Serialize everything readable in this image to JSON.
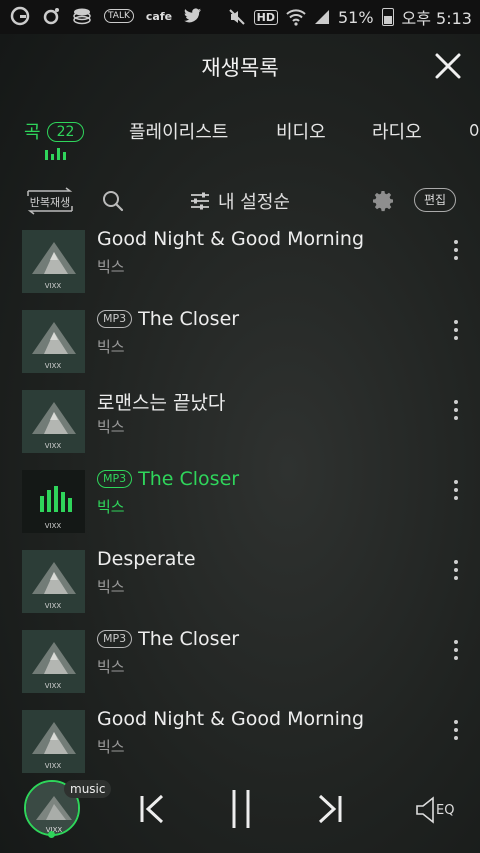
{
  "status_bar": {
    "left_icons": [
      "g-icon",
      "o-icon",
      "coin-icon",
      "talk-icon",
      "cafe-icon",
      "twitter-icon"
    ],
    "talk_label": "TALK",
    "cafe_label": "cafe",
    "hd_label": "HD",
    "battery": "51%",
    "time": "오후 5:13"
  },
  "header": {
    "title": "재생목록"
  },
  "tabs": [
    {
      "label": "곡",
      "count": "22",
      "active": true
    },
    {
      "label": "플레이리스트"
    },
    {
      "label": "비디오"
    },
    {
      "label": "라디오"
    },
    {
      "label": "아"
    }
  ],
  "toolbar": {
    "repeat_label": "반복재생",
    "sort_label": "내 설정순",
    "edit_label": "편집"
  },
  "album_label": "VIXX",
  "tracks": [
    {
      "title": "Good Night & Good Morning",
      "artist": "빅스",
      "mp3": false,
      "playing": false
    },
    {
      "title": "The Closer",
      "artist": "빅스",
      "mp3": true,
      "playing": false
    },
    {
      "title": "로맨스는 끝났다",
      "artist": "빅스",
      "mp3": false,
      "playing": false
    },
    {
      "title": "The Closer",
      "artist": "빅스",
      "mp3": true,
      "playing": true
    },
    {
      "title": "Desperate",
      "artist": "빅스",
      "mp3": false,
      "playing": false
    },
    {
      "title": "The Closer",
      "artist": "빅스",
      "mp3": true,
      "playing": false
    },
    {
      "title": "Good Night & Good Morning",
      "artist": "빅스",
      "mp3": false,
      "playing": false
    }
  ],
  "mp3_badge": "MP3",
  "player": {
    "tag": "music",
    "eq_label": "EQ"
  },
  "colors": {
    "accent": "#2fd55b",
    "background": "#1f2220"
  }
}
